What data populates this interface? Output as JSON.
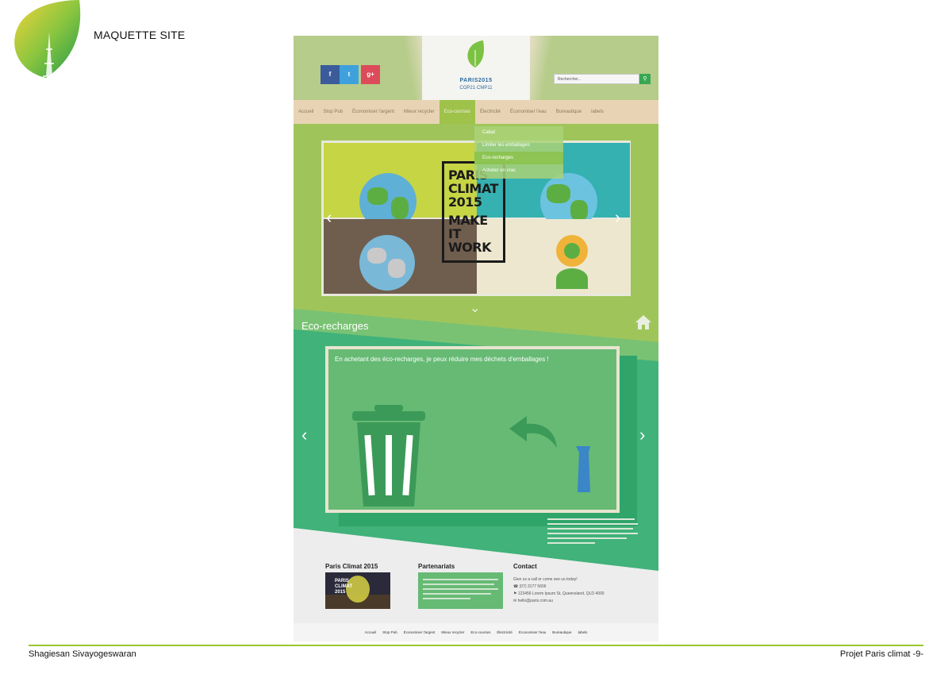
{
  "slide": {
    "title": "MAQUETTE SITE",
    "author": "Shagiesan Sivayogeswaran",
    "project": "Projet Paris climat -9-"
  },
  "mockup": {
    "logo": {
      "line1": "PARIS2015",
      "line2": "COP21·CMP11"
    },
    "social": [
      {
        "label": "f",
        "icon": "facebook-icon"
      },
      {
        "label": "t",
        "icon": "twitter-icon"
      },
      {
        "label": "g+",
        "icon": "google-plus-icon"
      }
    ],
    "search": {
      "placeholder": "Rechercher..."
    },
    "nav": [
      "Accueil",
      "Stop Pub",
      "Économiser l'argent",
      "Mieux recycler",
      "Eco-courses",
      "Électricité",
      "Économiser l'eau",
      "Bureautique",
      "labels"
    ],
    "nav_active": "Eco-courses",
    "dropdown": [
      "Cabat",
      "Limiter les emballages",
      "Eco-recharges",
      "Acheter en vrac"
    ],
    "hero_poster": [
      "PARIS",
      "CLIMAT",
      "2015",
      "MAKE IT",
      "WORK"
    ],
    "section_title": "Eco-recharges",
    "panel_text": "En achetant des éco-recharges, je peux réduire mes déchets d'emballages !",
    "footer": {
      "col1_title": "Paris Climat 2015",
      "col2_title": "Partenariats",
      "col3_title": "Contact",
      "contact_lines": [
        "Give us a call or come see us today!",
        "(07) 3177 5656",
        "123456 Lorem Ipsum St, Queensland, QLD 4000",
        "hello@paris.com.au"
      ]
    },
    "bottom_nav": [
      "Accueil",
      "Stop Pub",
      "Économiser l'argent",
      "Mieux recycler",
      "Eco-courses",
      "Électricité",
      "Économiser l'eau",
      "Bureautique",
      "labels"
    ]
  },
  "colors": {
    "accent": "#9bc531",
    "green": "#40b27a",
    "nav_bg": "#e8d4b4"
  }
}
